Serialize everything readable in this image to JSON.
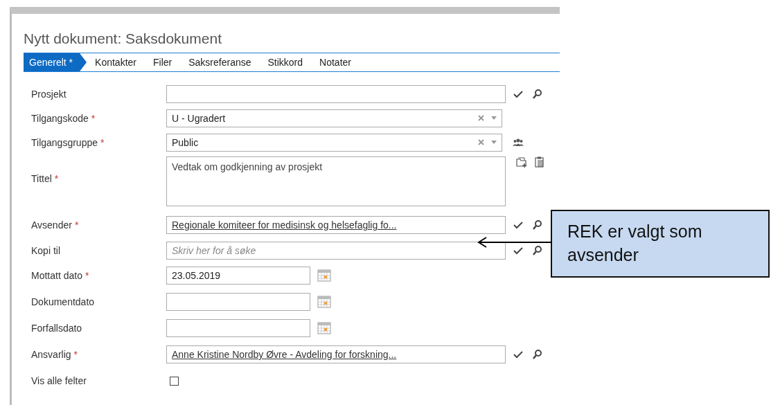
{
  "window": {
    "title": "Nytt dokument: Saksdokument"
  },
  "tabs": [
    {
      "label": "Generelt *",
      "selected": true
    },
    {
      "label": "Kontakter",
      "selected": false
    },
    {
      "label": "Filer",
      "selected": false
    },
    {
      "label": "Saksreferanse",
      "selected": false
    },
    {
      "label": "Stikkord",
      "selected": false
    },
    {
      "label": "Notater",
      "selected": false
    }
  ],
  "fields": [
    {
      "kind": "lookup",
      "label": "Prosjekt"
    },
    {
      "kind": "combo",
      "label": "Tilgangskode",
      "required_mark": "*",
      "value": "U - Ugradert"
    },
    {
      "kind": "groupcombo",
      "label": "Tilgangsgruppe",
      "required_mark": "*",
      "value": "Public"
    },
    {
      "kind": "textarea",
      "label": "Tittel",
      "required_mark": "*",
      "value": "Vedtak om godkjenning av prosjekt"
    },
    {
      "kind": "linklookup",
      "label": "Avsender",
      "required_mark": "*",
      "value": "Regionale komiteer for medisinsk og helsefaglig fo..."
    },
    {
      "kind": "lookup",
      "label": "Kopi til",
      "placeholder": "Skriv her for å søke"
    },
    {
      "kind": "date",
      "label": "Mottatt dato",
      "required_mark": "*",
      "value": "23.05.2019"
    },
    {
      "kind": "date",
      "label": "Dokumentdato"
    },
    {
      "kind": "date",
      "label": "Forfallsdato"
    },
    {
      "kind": "linklookup",
      "label": "Ansvarlig",
      "required_mark": "*",
      "value": "Anne Kristine Nordby Øvre - Avdeling for forskning..."
    },
    {
      "kind": "checkbox",
      "label": "Vis alle felter",
      "checked": false
    }
  ],
  "callout": {
    "text": "REK er valgt som avsender"
  }
}
